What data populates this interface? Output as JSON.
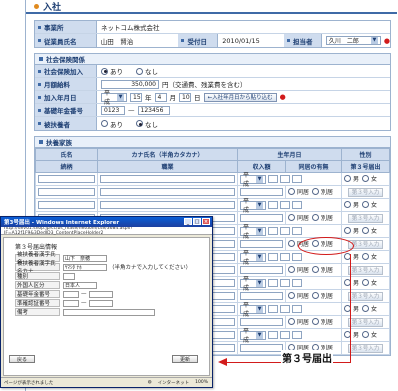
{
  "header": {
    "title": "入社"
  },
  "basic": {
    "company_label": "事業所",
    "company_value": "ネットコム株式会社",
    "employee_label": "従業員氏名",
    "employee_value": "山田　賢治",
    "accept_label": "受付日",
    "accept_value": "2010/01/15",
    "handler_label": "担当者",
    "handler_value": "久川　二郎"
  },
  "insurance": {
    "section_title": "社会保険関係",
    "join_label": "社会保険加入",
    "join_yes": "あり",
    "join_no": "なし",
    "salary_label": "月額給料",
    "salary_value": "350,000",
    "salary_note": "円（交通費、残業費を含む）",
    "date_label": "加入年月日",
    "era": "平成",
    "year": "15",
    "year_unit": "年",
    "month": "4",
    "month_unit": "月",
    "day": "10",
    "day_unit": "日",
    "copy_button": "←入社年月日から貼り込む",
    "pension_label": "基礎年金番号",
    "pension_a": "0123",
    "pension_sep": "—",
    "pension_b": "123456",
    "insured_label": "被扶養者",
    "insured_yes": "あり",
    "insured_no": "なし"
  },
  "dependents": {
    "section_title": "扶養家族",
    "headers": {
      "name": "氏名",
      "kana": "カナ氏名（半角カタカナ）",
      "birth": "生年月日",
      "gender": "性別",
      "relation": "続柄",
      "occupation": "職業",
      "income": "収入額",
      "cohabit": "同居の有無",
      "report": "第３号届出"
    },
    "rows": [
      {
        "era": "平成",
        "cohabit_yes": "同居",
        "cohabit_no": "別居",
        "report": "第３号入力",
        "male": "男",
        "female": "女"
      },
      {
        "era": "平成",
        "cohabit_yes": "同居",
        "cohabit_no": "別居",
        "report": "第３号入力",
        "male": "男",
        "female": "女"
      },
      {
        "era": "平成",
        "cohabit_yes": "同居",
        "cohabit_no": "別居",
        "report": "第３号入力",
        "male": "男",
        "female": "女"
      },
      {
        "era": "平成",
        "cohabit_yes": "同居",
        "cohabit_no": "別居",
        "report": "第３号入力",
        "male": "男",
        "female": "女"
      },
      {
        "era": "平成",
        "cohabit_yes": "同居",
        "cohabit_no": "別居",
        "report": "第３号入力",
        "male": "男",
        "female": "女"
      },
      {
        "era": "平成",
        "cohabit_yes": "同居",
        "cohabit_no": "別居",
        "report": "第３号入力",
        "male": "男",
        "female": "女"
      },
      {
        "era": "平成",
        "cohabit_yes": "同居",
        "cohabit_no": "別居",
        "report": "第３号入力",
        "male": "男",
        "female": "女"
      }
    ]
  },
  "popup": {
    "title": "第3号届出 - Windows Internet Explorer",
    "address": "http://dev01.shop.jp/cc/bs_mase/netdom/cse/3684.aspx?IF=A12f1F9&3DedID3_ContentPlaceHolder2",
    "heading": "第３号届出情報",
    "name_label": "被扶養者漢字氏名",
    "name_value": "山下　奈穂",
    "kana_label": "被扶養者漢字氏名カナ",
    "kana_value": "ﾔﾏｼﾀ ﾅﾎ",
    "kana_note": "（半角カナで入力してください）",
    "gender_label": "種別",
    "foreign_label": "外国人区分",
    "foreign_value": "日本人",
    "pension_label": "基礎年金番号",
    "address_label": "準確認証番号",
    "notes_label": "備考",
    "back_button": "戻る",
    "update_button": "更新",
    "status_text": "ページが表示されました",
    "zone": "インターネット",
    "zoom": "100%"
  },
  "callout": {
    "label": "第３号届出"
  }
}
